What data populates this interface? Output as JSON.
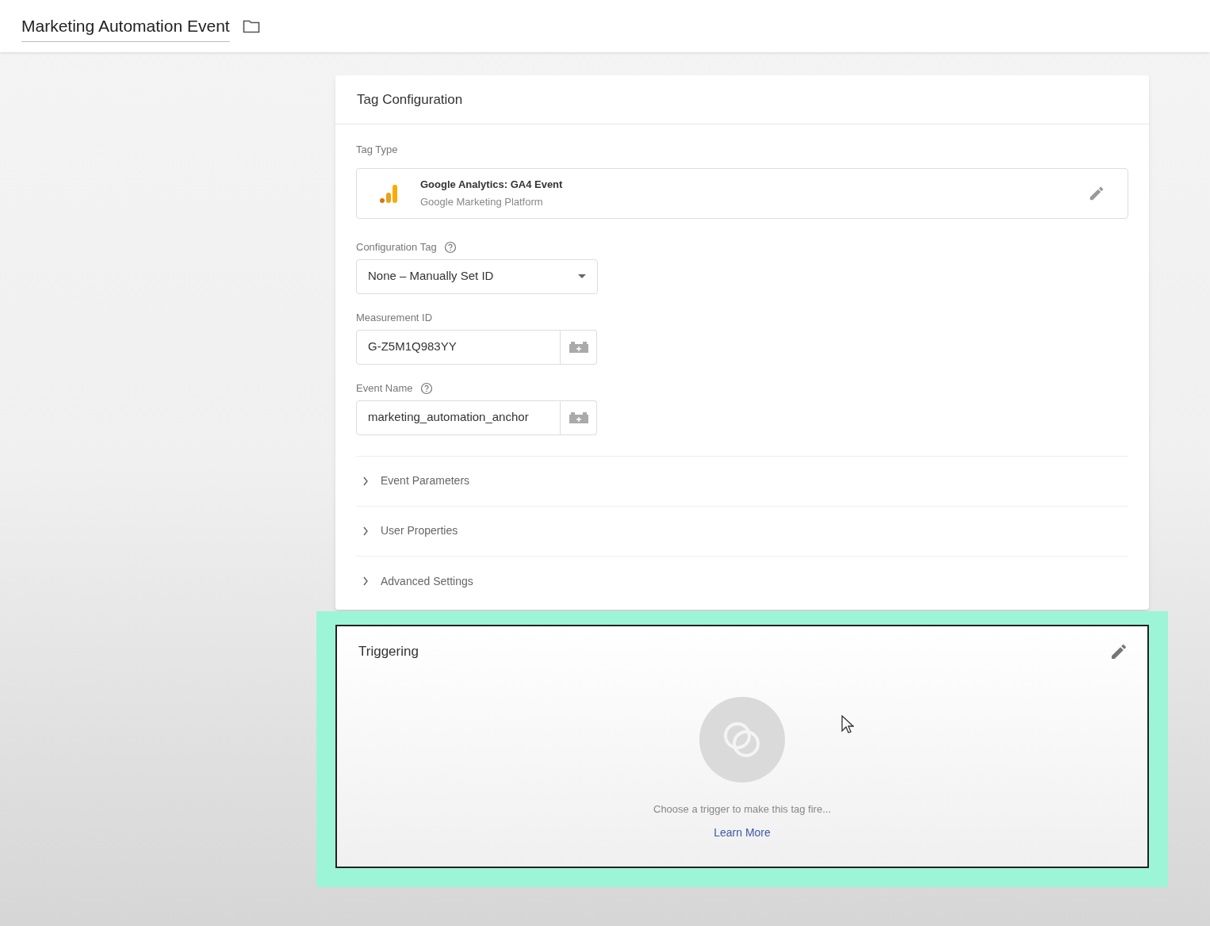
{
  "header": {
    "title": "Marketing Automation Event"
  },
  "tag_configuration": {
    "title": "Tag Configuration",
    "tag_type": {
      "label": "Tag Type",
      "name": "Google Analytics: GA4 Event",
      "subtitle": "Google Marketing Platform"
    },
    "fields": [
      {
        "kind": "select",
        "label": "Configuration Tag",
        "help": true,
        "value": "None – Manually Set ID"
      },
      {
        "kind": "variable",
        "label": "Measurement ID",
        "help": false,
        "value": "G-Z5M1Q983YY"
      },
      {
        "kind": "variable",
        "label": "Event Name",
        "help": true,
        "value": "marketing_automation_anchor"
      }
    ],
    "sections": [
      {
        "label": "Event Parameters",
        "expanded": false
      },
      {
        "label": "User Properties",
        "expanded": false
      },
      {
        "label": "Advanced Settings",
        "expanded": false
      }
    ]
  },
  "triggering": {
    "title": "Triggering",
    "highlighted": true,
    "message": "Choose a trigger to make this tag fire...",
    "link": "Learn More"
  }
}
